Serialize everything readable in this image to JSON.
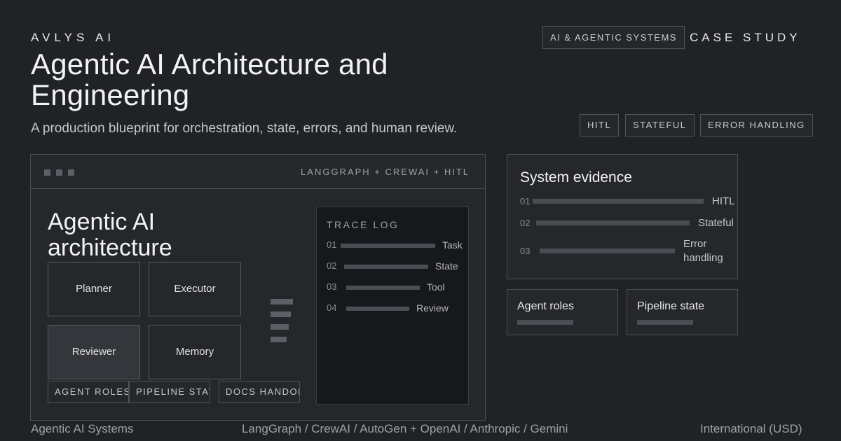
{
  "header": {
    "brand": "AVLYS AI",
    "title": "Agentic AI Architecture and Engineering",
    "subtitle": "A production blueprint for orchestration, state, errors, and human review.",
    "category_badge": "AI & AGENTIC SYSTEMS",
    "case_study": "CASE STUDY",
    "topic_tags": [
      "HITL",
      "STATEFUL",
      "ERROR HANDLING"
    ]
  },
  "panel": {
    "header_label": "LANGGRAPH + CREWAI + HITL",
    "title": "Agentic AI architecture",
    "nodes": [
      "Planner",
      "Executor",
      "Reviewer",
      "Memory"
    ],
    "bottom_tags": [
      "AGENT ROLES",
      "PIPELINE STATE",
      "DOCS HANDOFF"
    ],
    "trace_log": {
      "title": "TRACE LOG",
      "rows": [
        {
          "num": "01",
          "label": "Task"
        },
        {
          "num": "02",
          "label": "State"
        },
        {
          "num": "03",
          "label": "Tool"
        },
        {
          "num": "04",
          "label": "Review"
        }
      ]
    }
  },
  "evidence": {
    "title": "System evidence",
    "rows": [
      {
        "num": "01",
        "label": "HITL"
      },
      {
        "num": "02",
        "label": "Stateful"
      },
      {
        "num": "03",
        "label": "Error handling"
      }
    ]
  },
  "cards": [
    {
      "label": "Agent roles"
    },
    {
      "label": "Pipeline state"
    }
  ],
  "footer": {
    "left": "Agentic AI Systems",
    "middle": "LangGraph / CrewAI / AutoGen + OpenAI / Anthropic / Gemini",
    "right": "International (USD)"
  }
}
